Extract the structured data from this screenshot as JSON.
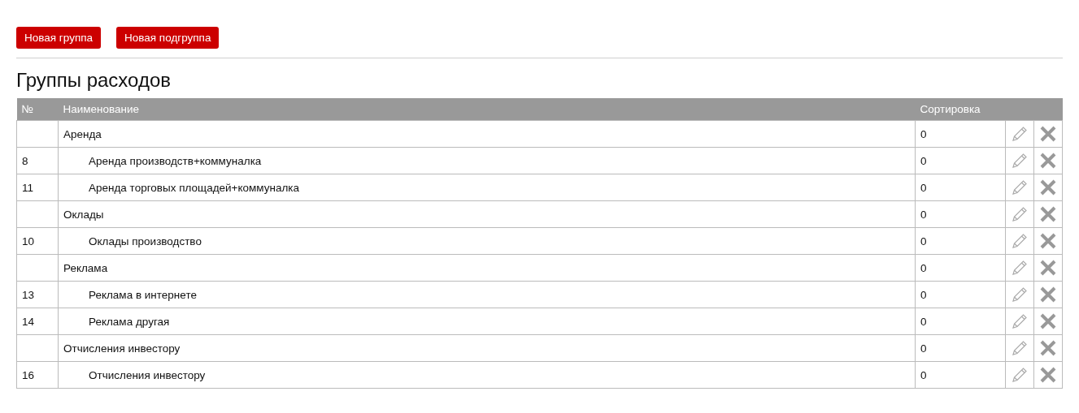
{
  "buttons": [
    "Новая группа",
    "Новая подгруппа"
  ],
  "title": "Группы расходов",
  "table": {
    "columns": [
      "№",
      "Наименование",
      "Сортировка"
    ],
    "groups": [
      {
        "name": "Аренда",
        "sort": "0",
        "children": [
          {
            "number": "8",
            "name": "Аренда производств+коммуналка",
            "sort": "0"
          },
          {
            "number": "11",
            "name": "Аренда торговых площадей+коммуналка",
            "sort": "0"
          }
        ]
      },
      {
        "name": "Оклады",
        "sort": "0",
        "children": [
          {
            "number": "10",
            "name": "Оклады производство",
            "sort": "0"
          }
        ]
      },
      {
        "name": "Реклама",
        "sort": "0",
        "children": [
          {
            "number": "13",
            "name": "Реклама в интернете",
            "sort": "0"
          },
          {
            "number": "14",
            "name": "Реклама другая",
            "sort": "0"
          }
        ]
      },
      {
        "name": "Отчисления инвестору",
        "sort": "0",
        "children": [
          {
            "number": "16",
            "name": "Отчисления инвестору",
            "sort": "0"
          }
        ]
      }
    ]
  }
}
